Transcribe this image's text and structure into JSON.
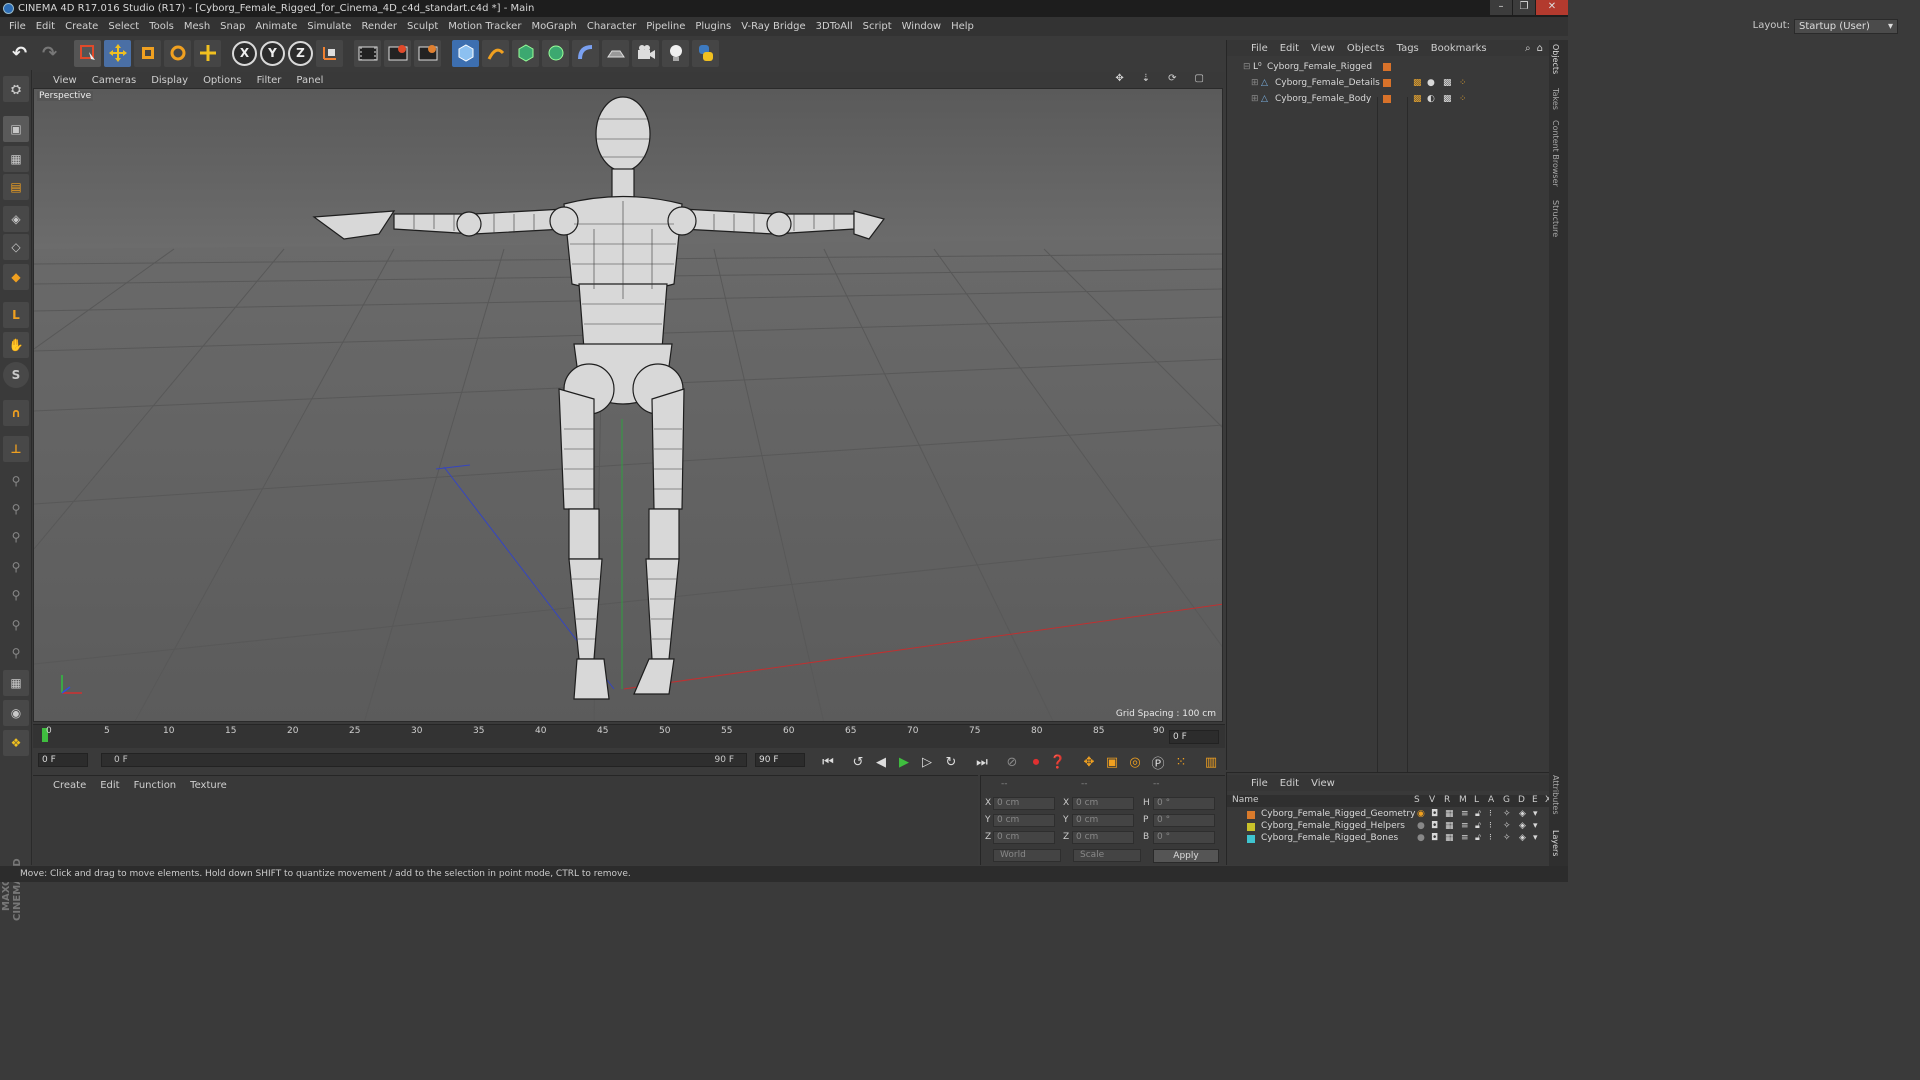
{
  "title": "CINEMA 4D R17.016 Studio (R17) - [Cyborg_Female_Rigged_for_Cinema_4D_c4d_standart.c4d *] - Main",
  "menu": [
    "File",
    "Edit",
    "Create",
    "Select",
    "Tools",
    "Mesh",
    "Snap",
    "Animate",
    "Simulate",
    "Render",
    "Sculpt",
    "Motion Tracker",
    "MoGraph",
    "Character",
    "Pipeline",
    "Plugins",
    "V-Ray Bridge",
    "3DToAll",
    "Script",
    "Window",
    "Help"
  ],
  "layout": {
    "label": "Layout:",
    "value": "Startup (User)"
  },
  "toolbar_axes": [
    "X",
    "Y",
    "Z"
  ],
  "viewport": {
    "menu": [
      "View",
      "Cameras",
      "Display",
      "Options",
      "Filter",
      "Panel"
    ],
    "camera": "Perspective",
    "grid_spacing": "Grid Spacing : 100 cm"
  },
  "timeline": {
    "ticks": [
      "0",
      "5",
      "10",
      "15",
      "20",
      "25",
      "30",
      "35",
      "40",
      "45",
      "50",
      "55",
      "60",
      "65",
      "70",
      "75",
      "80",
      "85",
      "90"
    ],
    "end_frame": "0 F"
  },
  "playback": {
    "current": "0 F",
    "range_start": "0 F",
    "range_end": "90 F",
    "max": "90 F"
  },
  "material_menu": [
    "Create",
    "Edit",
    "Function",
    "Texture"
  ],
  "coords": {
    "rows": [
      {
        "a": "X",
        "av": "0 cm",
        "b": "X",
        "bv": "0 cm",
        "c": "H",
        "cv": "0 °"
      },
      {
        "a": "Y",
        "av": "0 cm",
        "b": "Y",
        "bv": "0 cm",
        "c": "P",
        "cv": "0 °"
      },
      {
        "a": "Z",
        "av": "0 cm",
        "b": "Z",
        "bv": "0 cm",
        "c": "B",
        "cv": "0 °"
      }
    ],
    "mode": "World",
    "scale": "Scale",
    "apply": "Apply",
    "header": [
      "--",
      "--",
      "--"
    ]
  },
  "objects_menu": [
    "File",
    "Edit",
    "View",
    "Objects",
    "Tags",
    "Bookmarks"
  ],
  "objects": [
    {
      "name": "Cyborg_Female_Rigged",
      "indent": 0
    },
    {
      "name": "Cyborg_Female_Details",
      "indent": 1
    },
    {
      "name": "Cyborg_Female_Body",
      "indent": 1
    }
  ],
  "layers_menu": [
    "File",
    "Edit",
    "View"
  ],
  "layers_header": {
    "name": "Name",
    "cols": [
      "S",
      "V",
      "R",
      "M",
      "L",
      "A",
      "G",
      "D",
      "E",
      "X"
    ]
  },
  "layers": [
    {
      "name": "Cyborg_Female_Rigged_Geometry",
      "color": "#d97a2b"
    },
    {
      "name": "Cyborg_Female_Rigged_Helpers",
      "color": "#c9c22a"
    },
    {
      "name": "Cyborg_Female_Rigged_Bones",
      "color": "#3fc4cf"
    }
  ],
  "right_tabs": [
    "Objects",
    "Takes",
    "Content Browser",
    "Structure"
  ],
  "right_tabs_bottom": [
    "Attributes",
    "Layers"
  ],
  "status": "Move: Click and drag to move elements. Hold down SHIFT to quantize movement / add to the selection in point mode, CTRL to remove.",
  "brand": "MAXON CINEMA 4D"
}
